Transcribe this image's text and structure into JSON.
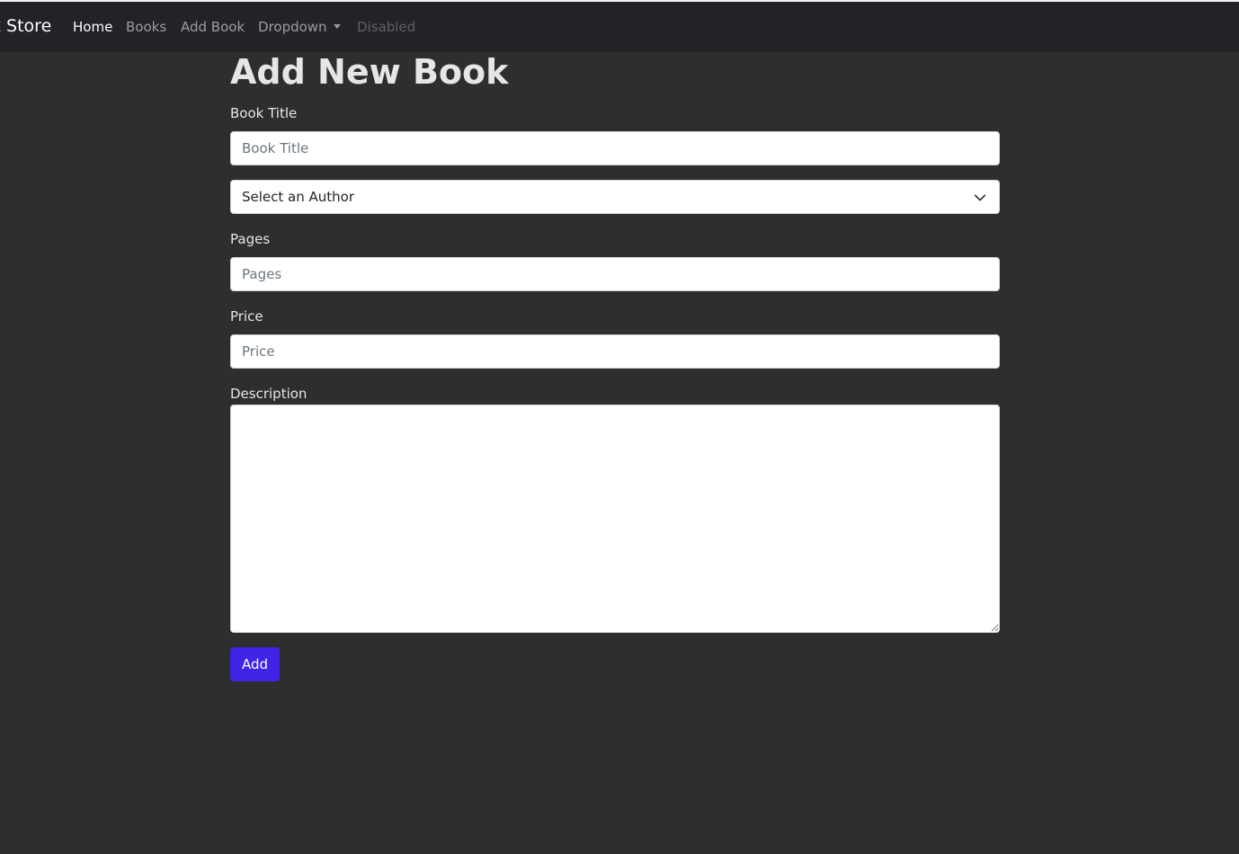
{
  "navbar": {
    "brand": "k Store",
    "links": [
      {
        "label": "Home",
        "state": "active"
      },
      {
        "label": "Books",
        "state": "normal"
      },
      {
        "label": "Add Book",
        "state": "normal"
      },
      {
        "label": "Dropdown",
        "state": "normal"
      },
      {
        "label": "Disabled",
        "state": "disabled"
      }
    ]
  },
  "form": {
    "title": "Add New Book",
    "book_title": {
      "label": "Book Title",
      "placeholder": "Book Title",
      "value": ""
    },
    "author": {
      "selected": "Select an Author"
    },
    "pages": {
      "label": "Pages",
      "placeholder": "Pages",
      "value": ""
    },
    "price": {
      "label": "Price",
      "placeholder": "Price",
      "value": ""
    },
    "description": {
      "label": "Description",
      "value": ""
    },
    "submit_label": "Add"
  },
  "colors": {
    "page_background": "#2e2e2e",
    "navbar_background": "#212326",
    "primary_button": "#3f23e6"
  },
  "icons": {
    "dropdown_toggle": "caret-down-icon",
    "select_toggle": "chevron-down-icon"
  }
}
